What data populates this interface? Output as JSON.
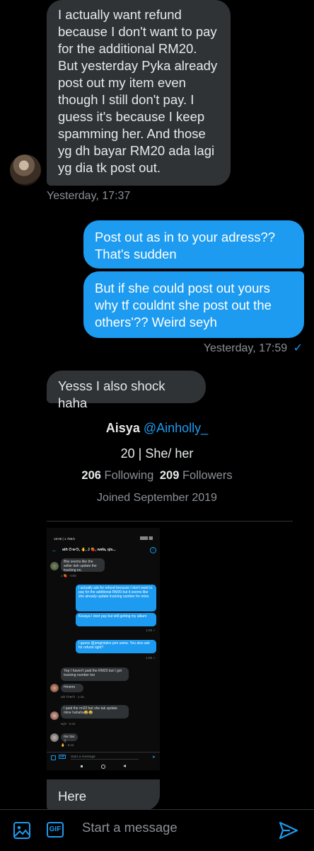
{
  "messages": [
    {
      "text": "I actually want refund because I don't want to pay for the additional RM20. But yesterday Pyka already post out my item even though I still don't pay. I guess it's because I keep spamming her. And those yg dh bayar RM20 ada lagi yg dia tk post out."
    },
    {
      "text": "Post out as in to your adress?? That's sudden"
    },
    {
      "text": "But if she could post out yours why tf couldnt she post out the others'?? Weird seyh"
    },
    {
      "text": "Yesss I also shock haha"
    },
    {
      "text": "Here"
    }
  ],
  "timestamps": {
    "received": "Yesterday, 17:37",
    "sent": "Yesterday, 17:59",
    "sent_check": "✓"
  },
  "profile": {
    "name": "Aisya",
    "handle": "@Ainholly_",
    "bio": "20 | She/ her",
    "following_count": "206",
    "following_label": "Following",
    "followers_count": "209",
    "followers_label": "Followers",
    "joined": "Joined September 2019"
  },
  "screenshot": {
    "status_time": "18:08 | 1.7kB/s",
    "chat_title": "ath ᕦ•ᴥ•ᕤ, 🤚, J 🍓, wafa, qis...",
    "msgs": [
      "Btw seems like the seller dah update the tracking no.",
      "I actually ask for refund because I don't want to pay for the additional RM20 but it seems like she already update tracking number for mine.",
      "Kesaya I dont pay but still getting my album",
      "I guess @jongintales pon sama. You also ask for refund right?",
      "Yep I haven't paid the RM20 but I got tracking number too",
      "Hmmm",
      "I paid the rm20 but she tak update mine hahaha😂😂",
      "me too :("
    ],
    "ts": [
      "J 🍓 · 0:50",
      "1:08 ✓",
      "1:09 ✓",
      "ath ᕦ•ᴥ•ᕤ · 1:15",
      "wyh · 5:41",
      "🤚 · 5:42"
    ],
    "compose_placeholder": "Start a message",
    "gif_label": "GIF"
  },
  "composer": {
    "placeholder": "Start a message",
    "gif_label": "GIF"
  },
  "colors": {
    "accent": "#1d9bf0",
    "incoming": "#2f3336",
    "background": "#000000"
  }
}
